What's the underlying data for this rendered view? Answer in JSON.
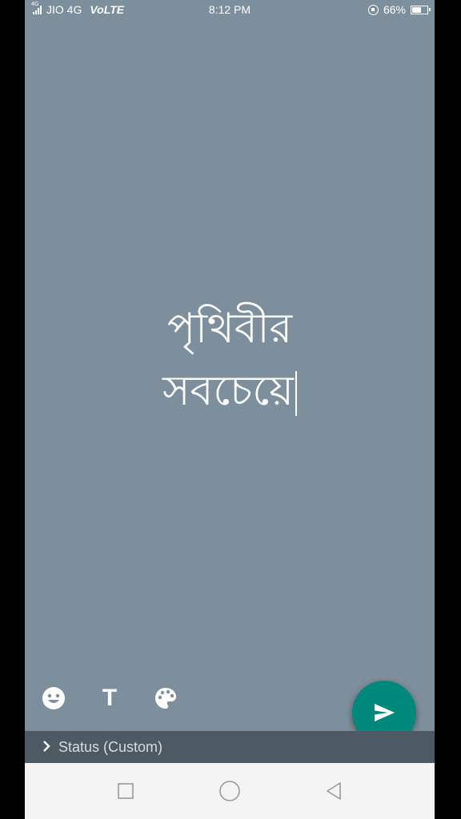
{
  "status_bar": {
    "network_small": "4G",
    "carrier": "JIO 4G",
    "volte": "VoLTE",
    "time": "8:12 PM",
    "battery": "66%",
    "battery_level": 0.66
  },
  "editor": {
    "lines": [
      "পৃথিবীর",
      "সবচেয়ে"
    ],
    "text_color": "#ffffff",
    "background_color": "#7d8f9c"
  },
  "toolbar": {
    "icons": [
      "emoji-icon",
      "text-style-icon",
      "palette-icon"
    ],
    "text_button": "T"
  },
  "send_button": {
    "icon": "send-icon",
    "color": "#00897b"
  },
  "audience": {
    "label": "Status (Custom)"
  },
  "nav": {
    "icons": [
      "recents-icon",
      "home-icon",
      "back-icon"
    ]
  }
}
